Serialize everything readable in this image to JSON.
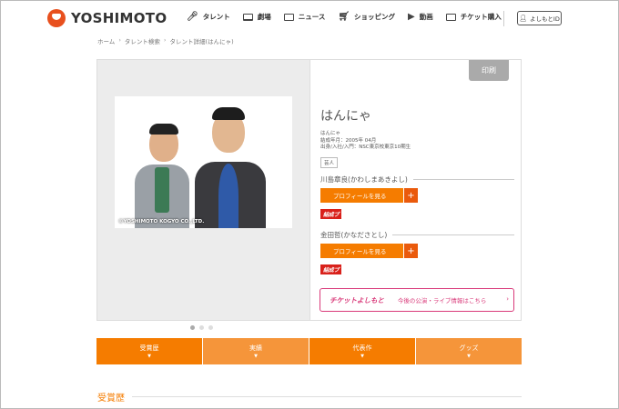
{
  "header": {
    "logo_text": "YOSHIMOTO",
    "nav": [
      {
        "icon": "mic-icon",
        "label": "タレント"
      },
      {
        "icon": "stage-icon",
        "label": "劇場"
      },
      {
        "icon": "news-icon",
        "label": "ニュース"
      },
      {
        "icon": "cart-icon",
        "label": "ショッピング"
      },
      {
        "icon": "video-icon",
        "label": "動画"
      },
      {
        "icon": "ticket-icon",
        "label": "チケット購入"
      }
    ],
    "login_label": "よしもとID"
  },
  "breadcrumb": [
    "ホーム",
    "タレント検索",
    "タレント詳細(はんにゃ)"
  ],
  "photo": {
    "copyright": "©YOSHIMOTO KOGYO CO.,LTD."
  },
  "info": {
    "print_label": "印刷",
    "name": "はんにゃ",
    "reading": "はんにゃ",
    "formed": "結成年月：2005年 04月",
    "origin": "出身/入社/入門：NSC東京校東京10期生",
    "tag": "芸人",
    "members": [
      {
        "name": "川島章良(かわしまあきよし)",
        "button": "プロフィールを見る",
        "badge": "結成ブ"
      },
      {
        "name": "金田哲(かなださとし)",
        "button": "プロフィールを見る",
        "badge": "結成ブ"
      }
    ],
    "ticket_logo": "チケットよしもと",
    "ticket_text": "今後の公演・ライブ情報はこちら"
  },
  "tabs": [
    "受賞歴",
    "実績",
    "代表作",
    "グッズ"
  ],
  "section_title": "受賞歴",
  "colors": {
    "accent": "#f57c00",
    "ticket": "#d93a7a",
    "logo": "#e8501e"
  }
}
